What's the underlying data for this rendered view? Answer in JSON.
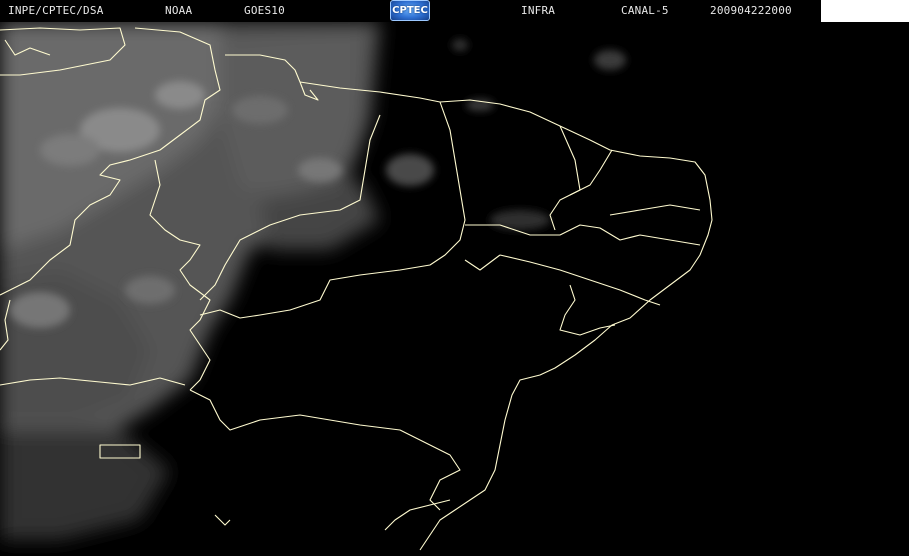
{
  "header": {
    "institution": "INPE/CPTEC/DSA",
    "agency": "NOAA",
    "satellite": "GOES10",
    "logo_text": "CPTEC",
    "product": "INFRA",
    "channel": "CANAL-5",
    "timestamp": "200904222000"
  },
  "colors": {
    "background": "#000000",
    "boundaries": "#fffbd0",
    "header_text": "#e8e8e8",
    "logo_blue": "#2e6fd1"
  },
  "map": {
    "type": "infrared satellite image",
    "region": "northeast Brazil"
  }
}
